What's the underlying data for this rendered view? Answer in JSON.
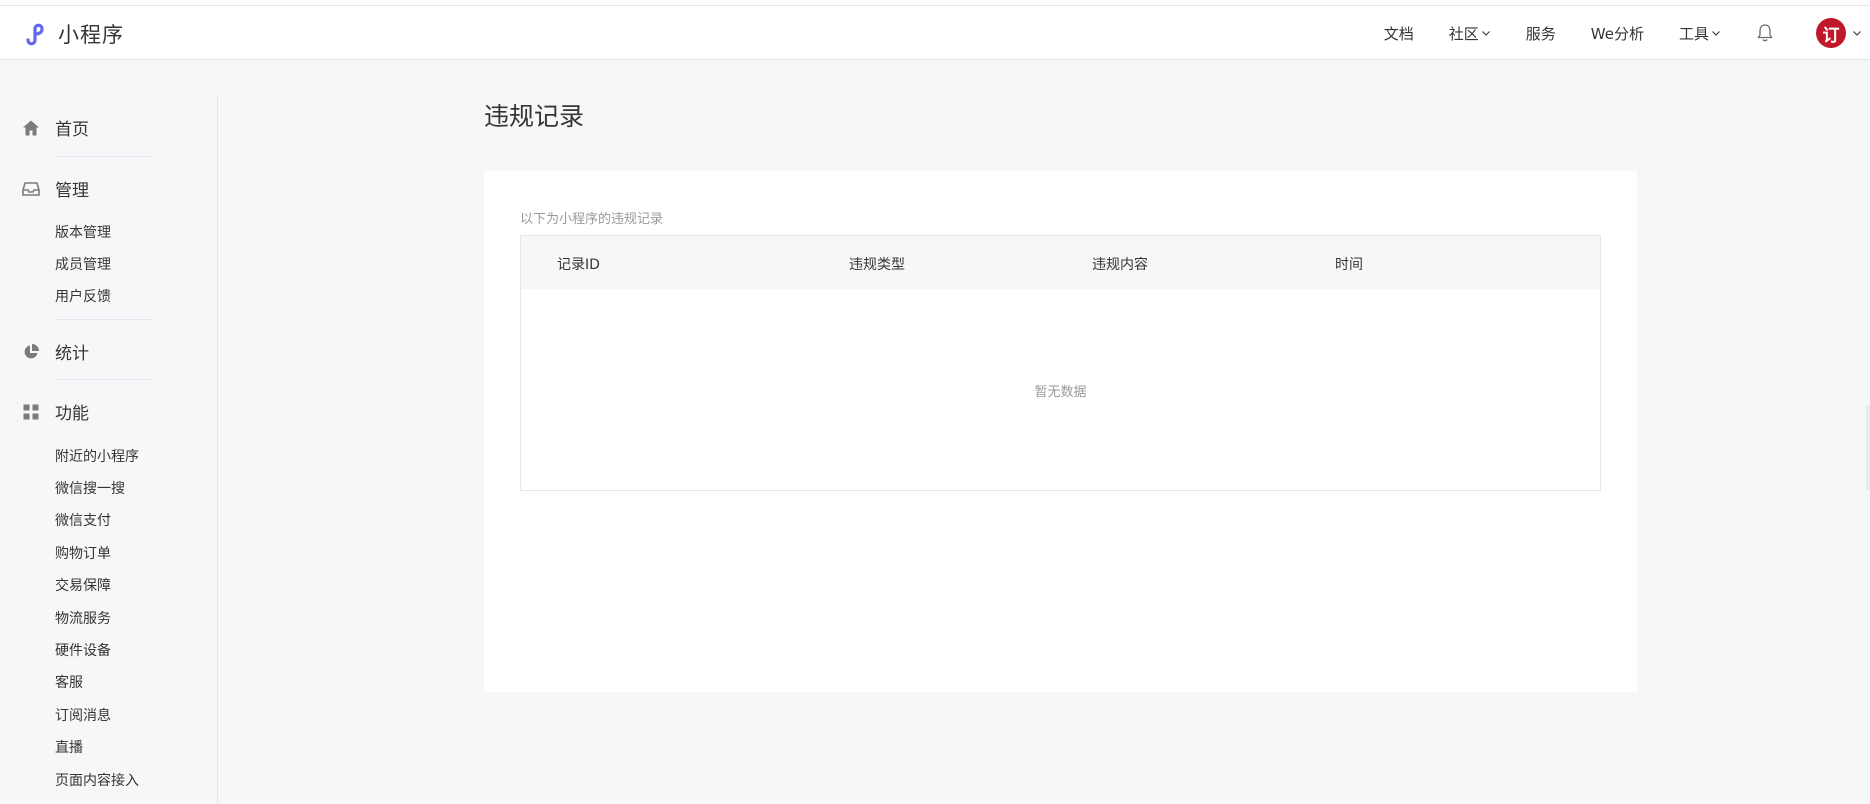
{
  "app": {
    "title": "小程序"
  },
  "nav": {
    "docs": "文档",
    "community": "社区",
    "service": "服务",
    "we_analysis": "We分析",
    "tools": "工具"
  },
  "avatar": {
    "glyph": "订"
  },
  "sidebar": {
    "home": "首页",
    "manage": {
      "label": "管理",
      "items": [
        "版本管理",
        "成员管理",
        "用户反馈"
      ]
    },
    "stats": "统计",
    "features": {
      "label": "功能",
      "items": [
        "附近的小程序",
        "微信搜一搜",
        "微信支付",
        "购物订单",
        "交易保障",
        "物流服务",
        "硬件设备",
        "客服",
        "订阅消息",
        "直播",
        "页面内容接入"
      ]
    }
  },
  "main": {
    "title": "违规记录",
    "desc": "以下为小程序的违规记录",
    "columns": [
      "记录ID",
      "违规类型",
      "违规内容",
      "时间"
    ],
    "empty": "暂无数据"
  },
  "colors": {
    "brand": "#6467f0",
    "avatar": "#c0182b",
    "text": "#353535",
    "muted": "#9a9a9a"
  }
}
